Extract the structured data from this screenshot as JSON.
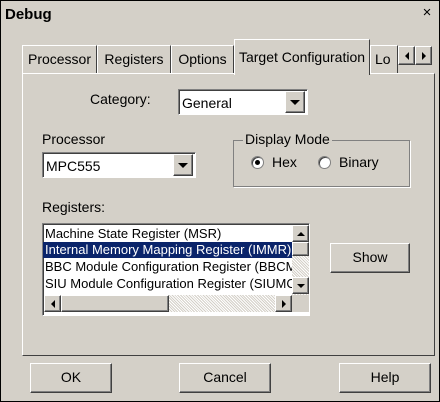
{
  "window": {
    "title": "Debug",
    "close_glyph": "×"
  },
  "tabs": [
    {
      "label": "Processor",
      "active": false
    },
    {
      "label": "Registers",
      "active": false
    },
    {
      "label": "Options",
      "active": false
    },
    {
      "label": "Target Configuration",
      "active": true
    },
    {
      "label": "Lo",
      "active": false
    }
  ],
  "category": {
    "label": "Category:",
    "value": "General"
  },
  "processor": {
    "label": "Processor",
    "value": "MPC555"
  },
  "display_mode": {
    "label": "Display Mode",
    "options": [
      {
        "label": "Hex",
        "selected": true
      },
      {
        "label": "Binary",
        "selected": false
      }
    ]
  },
  "registers": {
    "label": "Registers:",
    "items": [
      "Machine State Register (MSR)",
      "Internal Memory Mapping Register (IMMR)",
      "BBC Module Configuration Register (BBCMCR)",
      "SIU Module Configuration Register (SIUMCR)"
    ],
    "selected_index": 1
  },
  "buttons": {
    "show": "Show",
    "ok": "OK",
    "cancel": "Cancel",
    "help": "Help"
  },
  "colors": {
    "face": "#d4d0c8",
    "selection": "#0a246a"
  }
}
